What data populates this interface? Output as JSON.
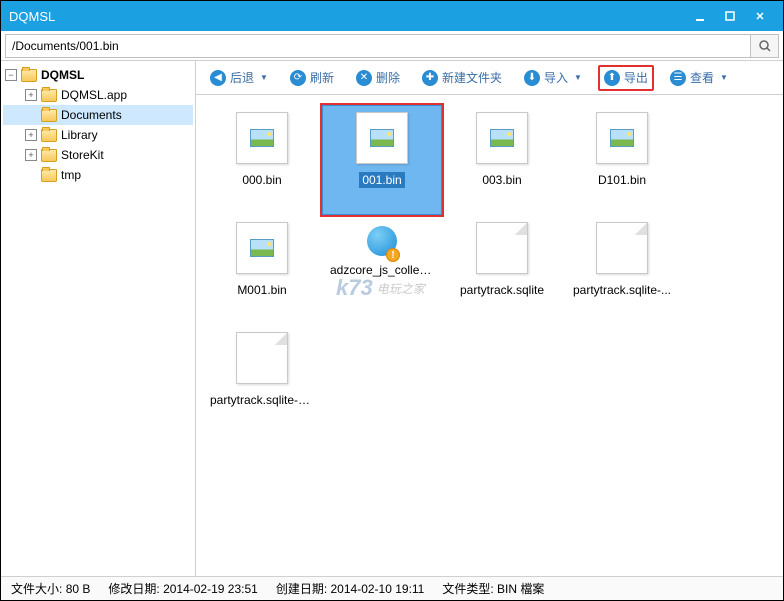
{
  "window": {
    "title": "DQMSL"
  },
  "path": "/Documents/001.bin",
  "tree": {
    "root": "DQMSL",
    "children": [
      {
        "label": "DQMSL.app",
        "expandable": true
      },
      {
        "label": "Documents",
        "expandable": false,
        "selected": true
      },
      {
        "label": "Library",
        "expandable": true
      },
      {
        "label": "StoreKit",
        "expandable": true
      },
      {
        "label": "tmp",
        "expandable": false
      }
    ]
  },
  "toolbar": {
    "back": "后退",
    "refresh": "刷新",
    "delete": "删除",
    "newfolder": "新建文件夹",
    "import": "导入",
    "export": "导出",
    "view": "查看"
  },
  "files": [
    {
      "name": "000.bin",
      "type": "image"
    },
    {
      "name": "001.bin",
      "type": "image",
      "selected": true,
      "highlighted": true
    },
    {
      "name": "003.bin",
      "type": "image"
    },
    {
      "name": "D101.bin",
      "type": "image"
    },
    {
      "name": "M001.bin",
      "type": "image"
    },
    {
      "name": "adzcore_js_collector",
      "type": "penguin"
    },
    {
      "name": "partytrack.sqlite",
      "type": "plain"
    },
    {
      "name": "partytrack.sqlite-...",
      "type": "plain"
    },
    {
      "name": "partytrack.sqlite-wal",
      "type": "plain"
    }
  ],
  "watermark": {
    "logo": "k73",
    "text": "电玩之家"
  },
  "status": {
    "size_label": "文件大小:",
    "size_value": "80 B",
    "modified_label": "修改日期:",
    "modified_value": "2014-02-19 23:51",
    "created_label": "创建日期:",
    "created_value": "2014-02-10 19:11",
    "type_label": "文件类型:",
    "type_value": "BIN 檔案"
  }
}
